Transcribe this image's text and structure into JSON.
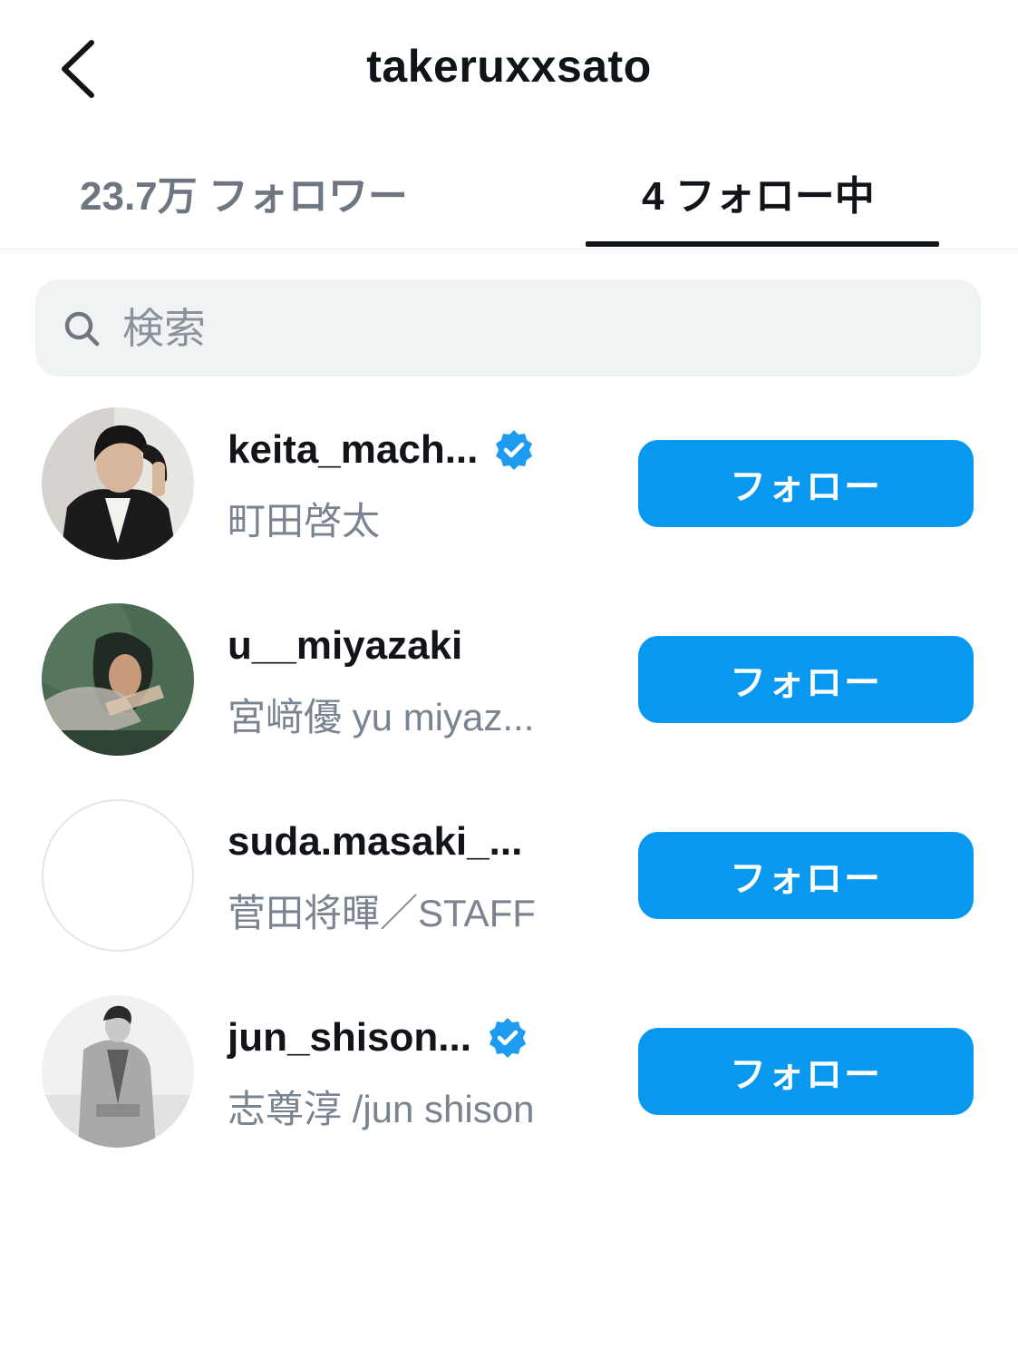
{
  "header": {
    "title": "takeruxxsato",
    "back_icon": "chevron-left-icon"
  },
  "tabs": {
    "followers_label": "23.7万 フォロワー",
    "following_label": "4 フォロー中",
    "active": "following"
  },
  "search": {
    "placeholder": "検索",
    "value": ""
  },
  "accent_color": "#0998f0",
  "verified_color": "#1d9bf0",
  "users": [
    {
      "username": "keita_mach...",
      "display_name": "町田啓太",
      "verified": true,
      "follow_label": "フォロー",
      "avatar": "photo"
    },
    {
      "username": "u__miyazaki",
      "display_name": "宮﨑優 yu miyaz...",
      "verified": false,
      "follow_label": "フォロー",
      "avatar": "photo"
    },
    {
      "username": "suda.masaki_...",
      "display_name": "菅田将暉／STAFF",
      "verified": false,
      "follow_label": "フォロー",
      "avatar": "blank"
    },
    {
      "username": "jun_shison...",
      "display_name": "志尊淳 /jun shison",
      "verified": true,
      "follow_label": "フォロー",
      "avatar": "photo"
    }
  ]
}
